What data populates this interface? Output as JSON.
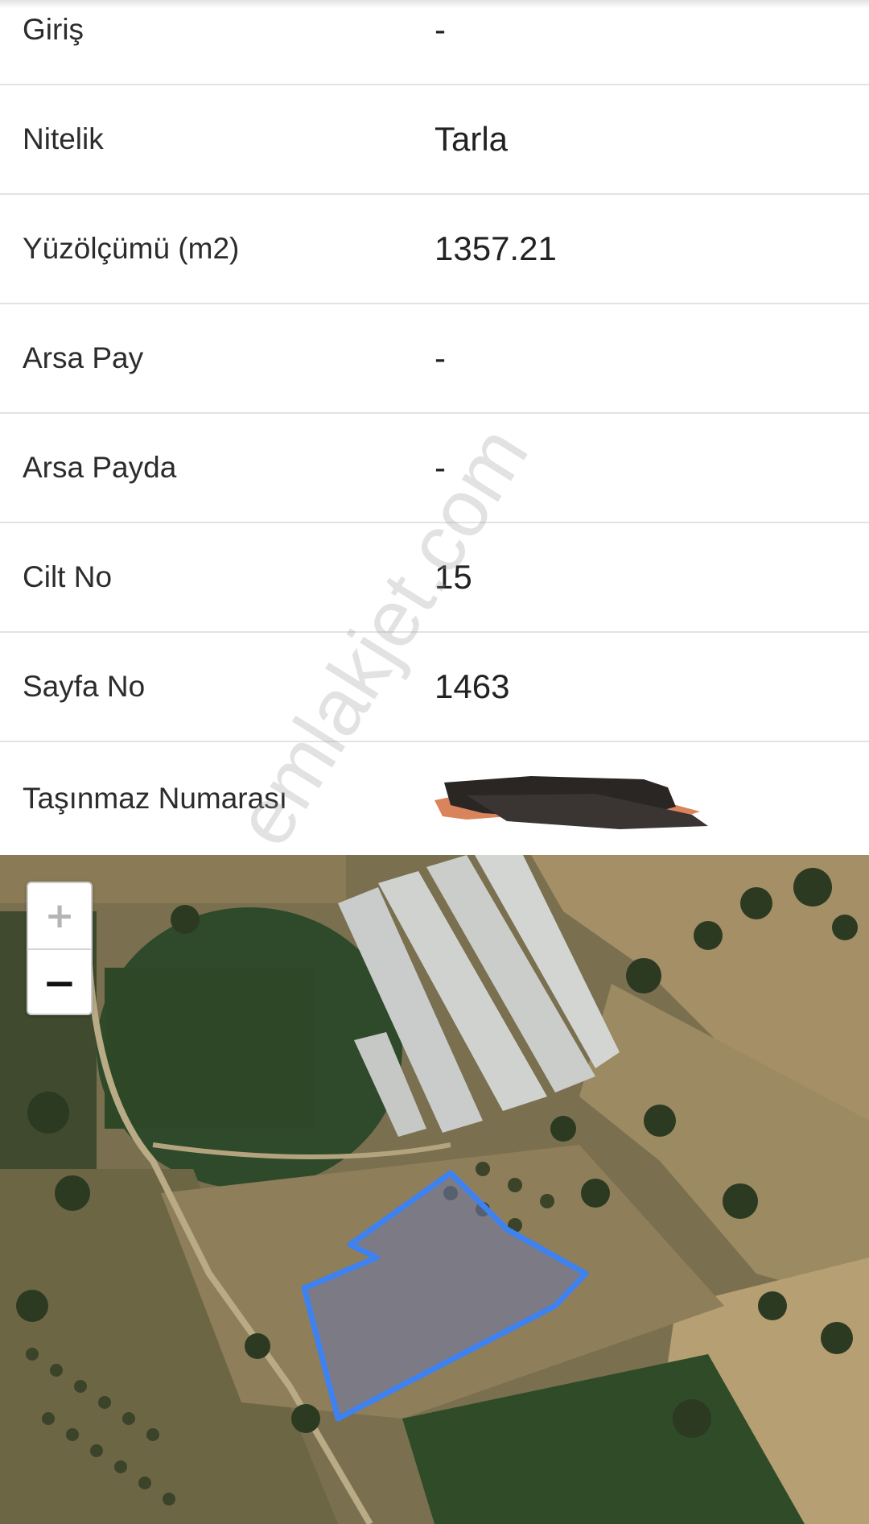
{
  "property_table": {
    "rows": [
      {
        "label": "Giriş",
        "value": "-"
      },
      {
        "label": "Nitelik",
        "value": "Tarla"
      },
      {
        "label": "Yüzölçümü (m2)",
        "value": "1357.21"
      },
      {
        "label": "Arsa Pay",
        "value": "-"
      },
      {
        "label": "Arsa Payda",
        "value": "-"
      },
      {
        "label": "Cilt No",
        "value": "15"
      },
      {
        "label": "Sayfa No",
        "value": "1463"
      },
      {
        "label": "Taşınmaz Numarası",
        "value": ""
      }
    ]
  },
  "map": {
    "zoom_in_label": "+",
    "zoom_out_label": "−",
    "parcel_outline_color": "#3d82f0"
  },
  "watermark": {
    "text": "emlakjet.com"
  },
  "colors": {
    "label_text": "#2c2c2c",
    "value_text": "#222222",
    "divider": "#e3e3e3",
    "redaction": "#2a2624",
    "redaction_accent": "#d6774a"
  }
}
